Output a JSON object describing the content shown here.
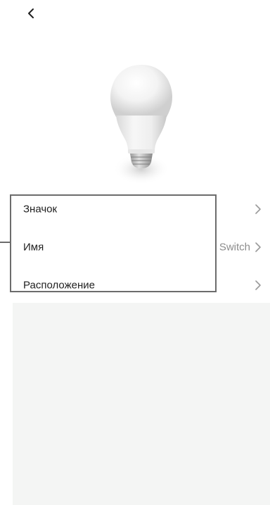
{
  "header": {
    "back_icon": "chevron-left-icon"
  },
  "device": {
    "image_icon": "light-bulb-icon"
  },
  "settings": {
    "rows": [
      {
        "label": "Значок",
        "value": "",
        "icon": "chevron-right-icon"
      },
      {
        "label": "Имя",
        "value": "Switch",
        "icon": "chevron-right-icon"
      },
      {
        "label": "Расположение",
        "value": "",
        "icon": "chevron-right-icon"
      }
    ]
  },
  "colors": {
    "background": "#ffffff",
    "text": "#1f1f1f",
    "secondary_text": "#8c8c8c",
    "chevron": "#9a9a9a",
    "highlight_frame": "#6c6c6c",
    "bottom_panel": "#f4f5f4"
  }
}
